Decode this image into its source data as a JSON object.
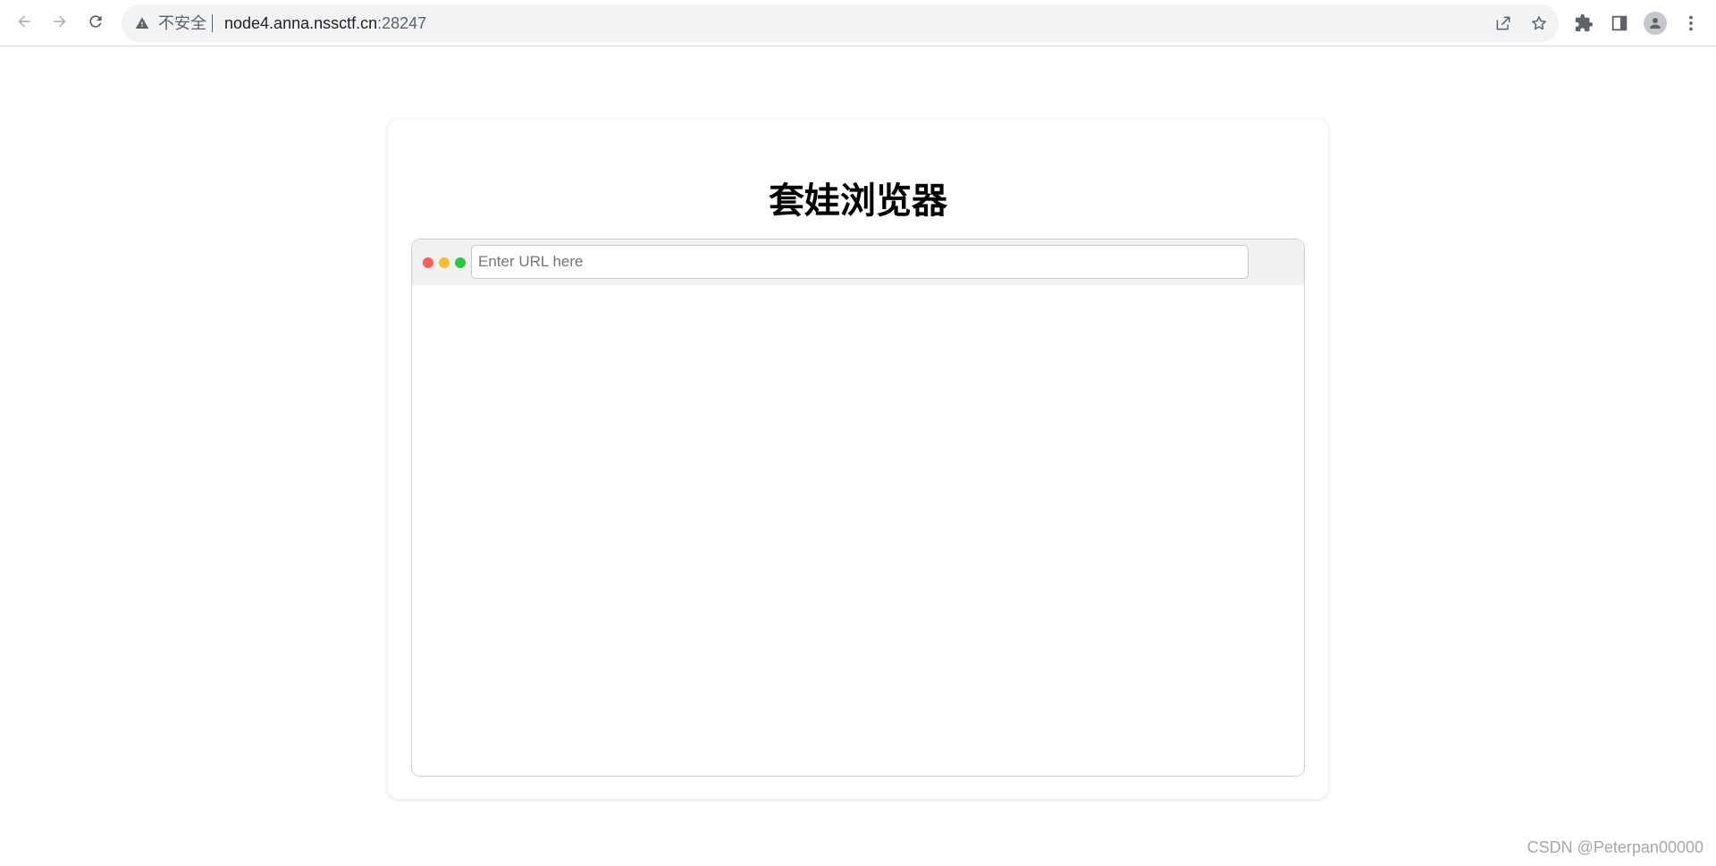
{
  "chrome": {
    "nav": {
      "back_icon": "arrow-left-icon",
      "forward_icon": "arrow-right-icon",
      "reload_icon": "reload-icon"
    },
    "omnibox": {
      "security_icon": "warning-triangle-icon",
      "security_label": "不安全",
      "url_host": "node4.anna.nssctf.cn",
      "url_port": ":28247",
      "share_icon": "share-icon",
      "bookmark_icon": "star-icon"
    },
    "toolbar": {
      "extensions_icon": "puzzle-icon",
      "side_panel_icon": "side-panel-icon",
      "profile_icon": "person-icon",
      "menu_icon": "kebab-menu-icon"
    }
  },
  "page": {
    "title": "套娃浏览器",
    "mini_browser": {
      "traffic_lights": {
        "red": "#ff5f57",
        "yellow": "#febc2e",
        "green": "#28c840"
      },
      "url_input": {
        "value": "",
        "placeholder": "Enter URL here"
      }
    }
  },
  "watermark": "CSDN @Peterpan00000"
}
